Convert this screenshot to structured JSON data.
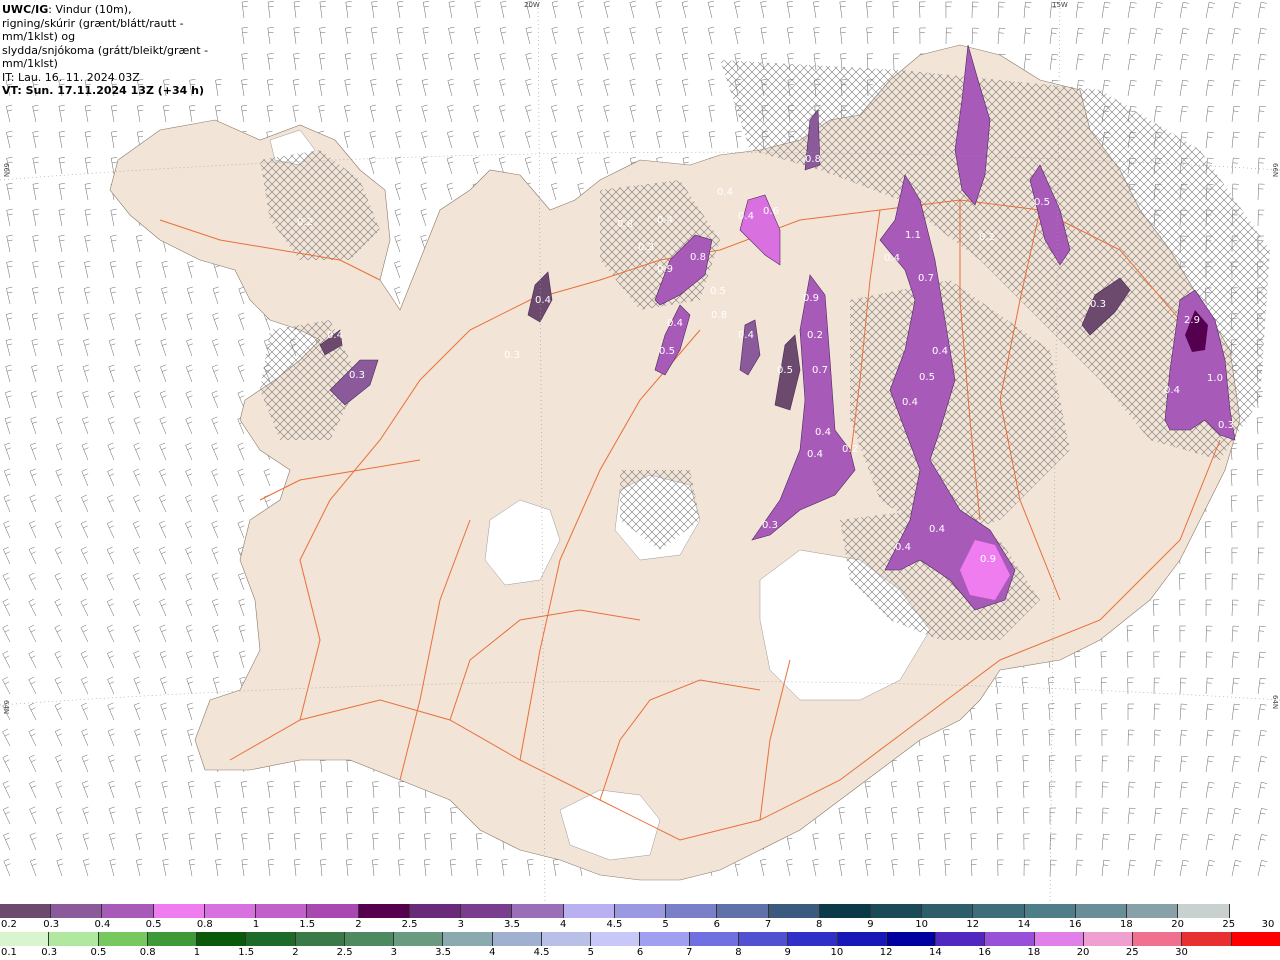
{
  "info": {
    "title_code": "UWC/IG",
    "title_rest": ": Vindur (10m),",
    "line2": "rigning/skúrir (grænt/blátt/rautt - mm/1klst) og",
    "line3": "slydda/snjókoma (grátt/bleikt/grænt - mm/1klst)",
    "line4": "IT: Lau. 16. 11. 2024 03Z",
    "line5": "VT: Sun. 17.11.2024 13Z (+34 h)"
  },
  "grid_labels": {
    "top_20w": "20W",
    "top_15w": "15W",
    "left_66n": "66N",
    "left_64n": "64N",
    "right_66n": "66N",
    "right_64n": "64N"
  },
  "colors": {
    "land": "#f2e4d6",
    "roads": "#e8703a",
    "glacier": "#ffffff",
    "sea": "#ffffff"
  },
  "precip_labels": [
    "0.2",
    "0.4",
    "0.3",
    "0.4",
    "0.3",
    "0.8",
    "0.4",
    "0.3",
    "0.9",
    "0.8",
    "0.5",
    "0.8",
    "0.4",
    "0.5",
    "0.4",
    "0.6",
    "0.4",
    "0.4",
    "0.8",
    "0.9",
    "0.2",
    "0.5",
    "0.7",
    "0.4",
    "0.4",
    "0.2",
    "0.3",
    "1.1",
    "0.7",
    "0.4",
    "0.4",
    "0.5",
    "0.4",
    "0.4",
    "0.9",
    "0.4",
    "2.9",
    "0.4",
    "1.0",
    "0.3",
    "0.3",
    "0.5",
    "0.2"
  ],
  "legend_snow": {
    "colors": [
      "#6b4a6e",
      "#8b5a9a",
      "#a85ab8",
      "#f07df0",
      "#d870e0",
      "#c060c8",
      "#a848b0",
      "#55004f",
      "#6a2a7a",
      "#7a3d8e",
      "#9a6fb8",
      "#b8b0f0",
      "#9a98e0",
      "#7a80c8",
      "#6070a8",
      "#3a5a80",
      "#0a3a48",
      "#1a4a58",
      "#2e5e6a",
      "#3e6e7a",
      "#4e7e88",
      "#6a8e98",
      "#88a0a8",
      "#c8d0d0",
      "#ffffff"
    ],
    "labels": [
      "0.2",
      "0.3",
      "0.4",
      "0.5",
      "0.8",
      "1",
      "1.5",
      "2",
      "2.5",
      "3",
      "3.5",
      "4",
      "4.5",
      "5",
      "6",
      "7",
      "8",
      "9",
      "10",
      "12",
      "14",
      "16",
      "18",
      "20",
      "25",
      "30"
    ]
  },
  "legend_rain": {
    "colors": [
      "#d8f5d0",
      "#b0e8a0",
      "#78c860",
      "#3e9a38",
      "#0a5a0a",
      "#1e6a28",
      "#3a7a48",
      "#4e8a60",
      "#6a9a80",
      "#8aaab0",
      "#a0b0d0",
      "#b8c0e8",
      "#c8c8f8",
      "#a0a0f0",
      "#7070e0",
      "#5050d0",
      "#3030c8",
      "#1818b8",
      "#0000a0",
      "#5028c0",
      "#9850d8",
      "#e080e8",
      "#f0a0d0",
      "#f07090",
      "#e83030",
      "#ff0000"
    ],
    "labels": [
      "0.1",
      "0.3",
      "0.5",
      "0.8",
      "1",
      "1.5",
      "2",
      "2.5",
      "3",
      "3.5",
      "4",
      "4.5",
      "5",
      "6",
      "7",
      "8",
      "9",
      "10",
      "12",
      "14",
      "16",
      "18",
      "20",
      "25",
      "30"
    ]
  }
}
